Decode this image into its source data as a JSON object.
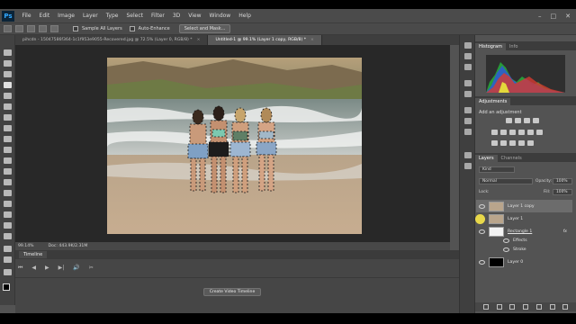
{
  "menu": {
    "logo": "Ps",
    "items": [
      "File",
      "Edit",
      "Image",
      "Layer",
      "Type",
      "Select",
      "Filter",
      "3D",
      "View",
      "Window",
      "Help"
    ],
    "window_controls": [
      "–",
      "□",
      "✕"
    ]
  },
  "options_bar": {
    "sample_all_layers": "Sample All Layers",
    "auto_enhance": "Auto-Enhance",
    "select_and_mask": "Select and Mask..."
  },
  "doc_tabs": [
    {
      "label": "pihcdn - 15047586f364-1c1f953e9055-Recovered.jpg @ 72.5% (Layer 0, RGB/8) *",
      "active": false
    },
    {
      "label": "Untitled-1 @ 99.1% (Layer 1 copy, RGB/8) *",
      "active": true
    }
  ],
  "status": {
    "zoom": "99.14%",
    "doc_size": "Doc: 443.9K/2.31M"
  },
  "timeline": {
    "tab_label": "Timeline",
    "controls": [
      "⏮",
      "◀",
      "▶",
      "▶|",
      "🔊",
      "✂"
    ],
    "create_button": "Create Video Timeline"
  },
  "panels": {
    "histogram_tabs": [
      "Histogram",
      "Info"
    ],
    "adjustments_tab": "Adjustments",
    "adjustments_title": "Add an adjustment",
    "layers_tabs": [
      "Layers",
      "Channels"
    ],
    "kind_filter": "Kind",
    "blend_mode": "Normal",
    "opacity_label": "Opacity:",
    "opacity_value": "100%",
    "lock_label": "Lock:",
    "fill_label": "Fill:",
    "fill_value": "100%"
  },
  "layers": [
    {
      "name": "Layer 1 copy",
      "selected": true,
      "thumb_color": "#b9a58c"
    },
    {
      "name": "Layer 1",
      "selected": false,
      "thumb_color": "#b9a58c"
    },
    {
      "name": "Rectangle 1",
      "selected": false,
      "thumb_color": "#f2f2f2",
      "fx": "fx"
    },
    {
      "name": "Effects",
      "sub": true
    },
    {
      "name": "Stroke",
      "sub": true
    },
    {
      "name": "Layer 0",
      "selected": false,
      "thumb_color": "#000000"
    }
  ]
}
